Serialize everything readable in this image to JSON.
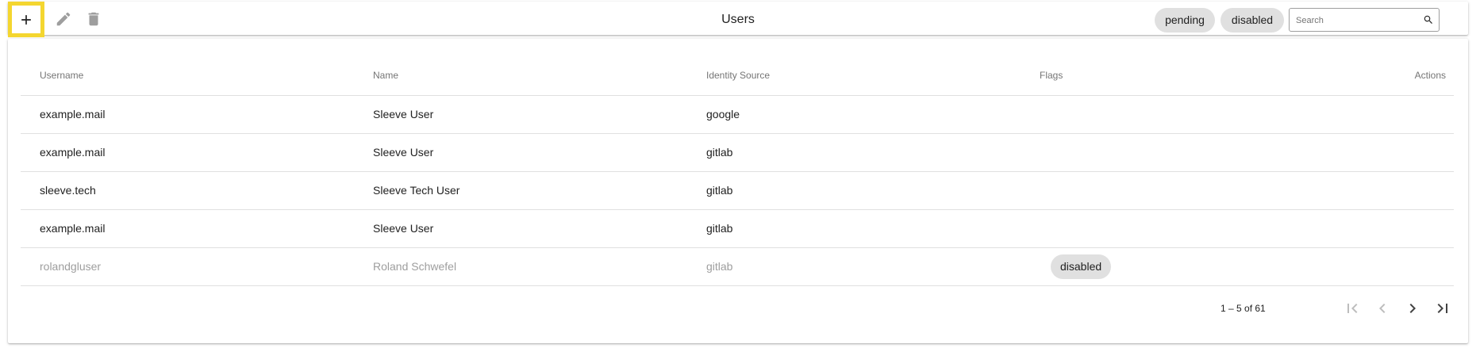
{
  "toolbar": {
    "title": "Users",
    "add_icon": "plus-icon",
    "edit_icon": "pencil-icon",
    "delete_icon": "trash-icon",
    "filters": [
      "pending",
      "disabled"
    ],
    "search": {
      "placeholder": "Search",
      "value": ""
    },
    "search_icon": "magnifier-icon",
    "highlight_color": "#f4d630"
  },
  "table": {
    "columns": [
      "Username",
      "Name",
      "Identity Source",
      "Flags",
      "Actions"
    ],
    "rows": [
      {
        "username": "example.mail",
        "name": "Sleeve User",
        "source": "google",
        "flag": "",
        "muted": false
      },
      {
        "username": "example.mail",
        "name": "Sleeve User",
        "source": "gitlab",
        "flag": "",
        "muted": false
      },
      {
        "username": "sleeve.tech",
        "name": "Sleeve Tech User",
        "source": "gitlab",
        "flag": "",
        "muted": false
      },
      {
        "username": "example.mail",
        "name": "Sleeve User",
        "source": "gitlab",
        "flag": "",
        "muted": false
      },
      {
        "username": "rolandgluser",
        "name": "Roland Schwefel",
        "source": "gitlab",
        "flag": "disabled",
        "muted": true
      }
    ]
  },
  "paginator": {
    "range_label": "1 – 5 of 61",
    "first_icon": "first-page-icon",
    "prev_icon": "chevron-left-icon",
    "next_icon": "chevron-right-icon",
    "last_icon": "last-page-icon"
  }
}
